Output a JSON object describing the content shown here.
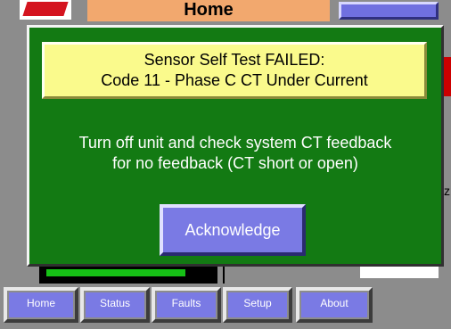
{
  "header": {
    "title": "Home"
  },
  "dialog": {
    "message_line1": "Sensor Self Test FAILED:",
    "message_line2": "Code 11 - Phase C CT Under Current",
    "instruction_line1": "Turn off unit and check system CT feedback",
    "instruction_line2": "for no feedback (CT short or open)",
    "acknowledge_label": "Acknowledge"
  },
  "background": {
    "partial_letter": "z"
  },
  "nav": {
    "home": "Home",
    "status": "Status",
    "faults": "Faults",
    "setup": "Setup",
    "about": "About"
  },
  "colors": {
    "dialog_bg": "#137a13",
    "message_bg": "#fafa8c",
    "button_bg": "#7a7ae4",
    "header_bg": "#f2a86e",
    "screen_bg": "#8c8c8c"
  }
}
